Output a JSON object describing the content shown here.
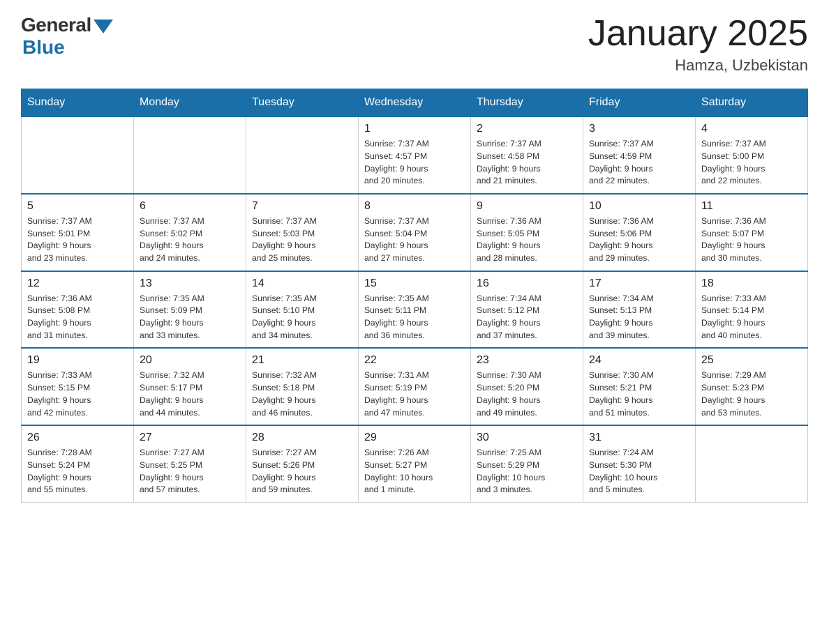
{
  "logo": {
    "general": "General",
    "blue": "Blue"
  },
  "header": {
    "month_year": "January 2025",
    "location": "Hamza, Uzbekistan"
  },
  "days_of_week": [
    "Sunday",
    "Monday",
    "Tuesday",
    "Wednesday",
    "Thursday",
    "Friday",
    "Saturday"
  ],
  "weeks": [
    [
      null,
      null,
      null,
      {
        "day": "1",
        "sunrise": "7:37 AM",
        "sunset": "4:57 PM",
        "daylight": "9 hours and 20 minutes."
      },
      {
        "day": "2",
        "sunrise": "7:37 AM",
        "sunset": "4:58 PM",
        "daylight": "9 hours and 21 minutes."
      },
      {
        "day": "3",
        "sunrise": "7:37 AM",
        "sunset": "4:59 PM",
        "daylight": "9 hours and 22 minutes."
      },
      {
        "day": "4",
        "sunrise": "7:37 AM",
        "sunset": "5:00 PM",
        "daylight": "9 hours and 22 minutes."
      }
    ],
    [
      {
        "day": "5",
        "sunrise": "7:37 AM",
        "sunset": "5:01 PM",
        "daylight": "9 hours and 23 minutes."
      },
      {
        "day": "6",
        "sunrise": "7:37 AM",
        "sunset": "5:02 PM",
        "daylight": "9 hours and 24 minutes."
      },
      {
        "day": "7",
        "sunrise": "7:37 AM",
        "sunset": "5:03 PM",
        "daylight": "9 hours and 25 minutes."
      },
      {
        "day": "8",
        "sunrise": "7:37 AM",
        "sunset": "5:04 PM",
        "daylight": "9 hours and 27 minutes."
      },
      {
        "day": "9",
        "sunrise": "7:36 AM",
        "sunset": "5:05 PM",
        "daylight": "9 hours and 28 minutes."
      },
      {
        "day": "10",
        "sunrise": "7:36 AM",
        "sunset": "5:06 PM",
        "daylight": "9 hours and 29 minutes."
      },
      {
        "day": "11",
        "sunrise": "7:36 AM",
        "sunset": "5:07 PM",
        "daylight": "9 hours and 30 minutes."
      }
    ],
    [
      {
        "day": "12",
        "sunrise": "7:36 AM",
        "sunset": "5:08 PM",
        "daylight": "9 hours and 31 minutes."
      },
      {
        "day": "13",
        "sunrise": "7:35 AM",
        "sunset": "5:09 PM",
        "daylight": "9 hours and 33 minutes."
      },
      {
        "day": "14",
        "sunrise": "7:35 AM",
        "sunset": "5:10 PM",
        "daylight": "9 hours and 34 minutes."
      },
      {
        "day": "15",
        "sunrise": "7:35 AM",
        "sunset": "5:11 PM",
        "daylight": "9 hours and 36 minutes."
      },
      {
        "day": "16",
        "sunrise": "7:34 AM",
        "sunset": "5:12 PM",
        "daylight": "9 hours and 37 minutes."
      },
      {
        "day": "17",
        "sunrise": "7:34 AM",
        "sunset": "5:13 PM",
        "daylight": "9 hours and 39 minutes."
      },
      {
        "day": "18",
        "sunrise": "7:33 AM",
        "sunset": "5:14 PM",
        "daylight": "9 hours and 40 minutes."
      }
    ],
    [
      {
        "day": "19",
        "sunrise": "7:33 AM",
        "sunset": "5:15 PM",
        "daylight": "9 hours and 42 minutes."
      },
      {
        "day": "20",
        "sunrise": "7:32 AM",
        "sunset": "5:17 PM",
        "daylight": "9 hours and 44 minutes."
      },
      {
        "day": "21",
        "sunrise": "7:32 AM",
        "sunset": "5:18 PM",
        "daylight": "9 hours and 46 minutes."
      },
      {
        "day": "22",
        "sunrise": "7:31 AM",
        "sunset": "5:19 PM",
        "daylight": "9 hours and 47 minutes."
      },
      {
        "day": "23",
        "sunrise": "7:30 AM",
        "sunset": "5:20 PM",
        "daylight": "9 hours and 49 minutes."
      },
      {
        "day": "24",
        "sunrise": "7:30 AM",
        "sunset": "5:21 PM",
        "daylight": "9 hours and 51 minutes."
      },
      {
        "day": "25",
        "sunrise": "7:29 AM",
        "sunset": "5:23 PM",
        "daylight": "9 hours and 53 minutes."
      }
    ],
    [
      {
        "day": "26",
        "sunrise": "7:28 AM",
        "sunset": "5:24 PM",
        "daylight": "9 hours and 55 minutes."
      },
      {
        "day": "27",
        "sunrise": "7:27 AM",
        "sunset": "5:25 PM",
        "daylight": "9 hours and 57 minutes."
      },
      {
        "day": "28",
        "sunrise": "7:27 AM",
        "sunset": "5:26 PM",
        "daylight": "9 hours and 59 minutes."
      },
      {
        "day": "29",
        "sunrise": "7:26 AM",
        "sunset": "5:27 PM",
        "daylight": "10 hours and 1 minute."
      },
      {
        "day": "30",
        "sunrise": "7:25 AM",
        "sunset": "5:29 PM",
        "daylight": "10 hours and 3 minutes."
      },
      {
        "day": "31",
        "sunrise": "7:24 AM",
        "sunset": "5:30 PM",
        "daylight": "10 hours and 5 minutes."
      },
      null
    ]
  ]
}
